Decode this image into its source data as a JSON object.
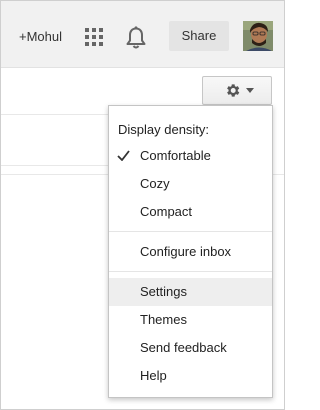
{
  "topbar": {
    "user_label": "+Mohul",
    "apps_icon": "apps-grid-icon",
    "notifications_icon": "bell-icon",
    "share_label": "Share",
    "avatar": "user-avatar"
  },
  "settings_button": {
    "icon": "gear-icon",
    "dropdown_icon": "caret-down-icon"
  },
  "menu": {
    "heading": "Display density:",
    "density_options": [
      {
        "label": "Comfortable",
        "checked": true
      },
      {
        "label": "Cozy",
        "checked": false
      },
      {
        "label": "Compact",
        "checked": false
      }
    ],
    "configure_label": "Configure inbox",
    "items": [
      {
        "label": "Settings",
        "highlighted": true
      },
      {
        "label": "Themes",
        "highlighted": false
      },
      {
        "label": "Send feedback",
        "highlighted": false
      },
      {
        "label": "Help",
        "highlighted": false
      }
    ]
  }
}
